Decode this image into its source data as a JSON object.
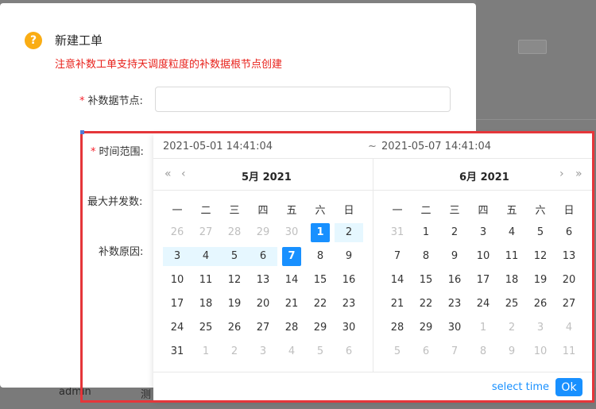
{
  "background": {
    "bottom_row": [
      "admin",
      "测"
    ]
  },
  "modal": {
    "icon_glyph": "?",
    "title": "新建工单",
    "warning": "注意补数工单支持天调度粒度的补数据根节点创建",
    "fields": {
      "node_label": "补数据节点:",
      "time_label": "时间范围:",
      "concurrency_label": "最大并发数:",
      "reason_label": "补数原因:"
    },
    "node_input_value": ""
  },
  "picker": {
    "start": "2021-05-01 14:41:04",
    "separator": "~",
    "end": "2021-05-07 14:41:04",
    "left_title": "5月 2021",
    "right_title": "6月 2021",
    "nav": {
      "prev_year": "«",
      "prev_month": "‹",
      "next_month": "›",
      "next_year": "»"
    },
    "weekdays": [
      "一",
      "二",
      "三",
      "四",
      "五",
      "六",
      "日"
    ],
    "left_weeks": [
      [
        {
          "d": "26",
          "o": 1
        },
        {
          "d": "27",
          "o": 1
        },
        {
          "d": "28",
          "o": 1
        },
        {
          "d": "29",
          "o": 1
        },
        {
          "d": "30",
          "o": 1
        },
        {
          "d": "1",
          "s": 1
        },
        {
          "d": "2",
          "r": 1
        }
      ],
      [
        {
          "d": "3",
          "r": 1
        },
        {
          "d": "4",
          "r": 1
        },
        {
          "d": "5",
          "r": 1
        },
        {
          "d": "6",
          "r": 1
        },
        {
          "d": "7",
          "s": 1
        },
        {
          "d": "8"
        },
        {
          "d": "9"
        }
      ],
      [
        {
          "d": "10"
        },
        {
          "d": "11"
        },
        {
          "d": "12"
        },
        {
          "d": "13"
        },
        {
          "d": "14"
        },
        {
          "d": "15"
        },
        {
          "d": "16"
        }
      ],
      [
        {
          "d": "17"
        },
        {
          "d": "18"
        },
        {
          "d": "19"
        },
        {
          "d": "20"
        },
        {
          "d": "21"
        },
        {
          "d": "22"
        },
        {
          "d": "23"
        }
      ],
      [
        {
          "d": "24"
        },
        {
          "d": "25"
        },
        {
          "d": "26"
        },
        {
          "d": "27"
        },
        {
          "d": "28"
        },
        {
          "d": "29"
        },
        {
          "d": "30"
        }
      ],
      [
        {
          "d": "31"
        },
        {
          "d": "1",
          "o": 1
        },
        {
          "d": "2",
          "o": 1
        },
        {
          "d": "3",
          "o": 1
        },
        {
          "d": "4",
          "o": 1
        },
        {
          "d": "5",
          "o": 1
        },
        {
          "d": "6",
          "o": 1
        }
      ]
    ],
    "right_weeks": [
      [
        {
          "d": "31",
          "o": 1
        },
        {
          "d": "1"
        },
        {
          "d": "2"
        },
        {
          "d": "3"
        },
        {
          "d": "4"
        },
        {
          "d": "5"
        },
        {
          "d": "6"
        }
      ],
      [
        {
          "d": "7"
        },
        {
          "d": "8"
        },
        {
          "d": "9"
        },
        {
          "d": "10"
        },
        {
          "d": "11"
        },
        {
          "d": "12"
        },
        {
          "d": "13"
        }
      ],
      [
        {
          "d": "14"
        },
        {
          "d": "15"
        },
        {
          "d": "16"
        },
        {
          "d": "17"
        },
        {
          "d": "18"
        },
        {
          "d": "19"
        },
        {
          "d": "20"
        }
      ],
      [
        {
          "d": "21"
        },
        {
          "d": "22"
        },
        {
          "d": "23"
        },
        {
          "d": "24"
        },
        {
          "d": "25"
        },
        {
          "d": "26"
        },
        {
          "d": "27"
        }
      ],
      [
        {
          "d": "28"
        },
        {
          "d": "29"
        },
        {
          "d": "30"
        },
        {
          "d": "1",
          "o": 1
        },
        {
          "d": "2",
          "o": 1
        },
        {
          "d": "3",
          "o": 1
        },
        {
          "d": "4",
          "o": 1
        }
      ],
      [
        {
          "d": "5",
          "o": 1
        },
        {
          "d": "6",
          "o": 1
        },
        {
          "d": "7",
          "o": 1
        },
        {
          "d": "8",
          "o": 1
        },
        {
          "d": "9",
          "o": 1
        },
        {
          "d": "10",
          "o": 1
        },
        {
          "d": "11",
          "o": 1
        }
      ]
    ],
    "footer": {
      "select_time": "select time",
      "ok": "Ok"
    }
  },
  "colors": {
    "primary": "#1890ff",
    "range_bg": "#e6f7ff",
    "warning_text": "#e8211b",
    "highlight_border": "#e5363a",
    "icon_bg": "#faad14"
  }
}
